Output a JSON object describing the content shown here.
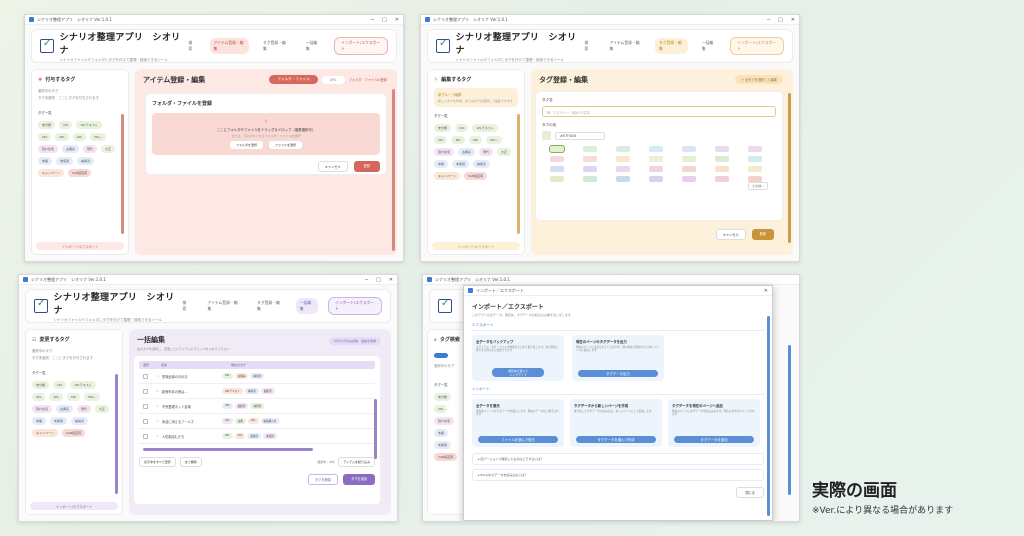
{
  "window": {
    "title": "シナリオ整理アプリ　シオリナ Ver.1.0.1",
    "controls": [
      "─",
      "□",
      "✕"
    ]
  },
  "app": {
    "title": "シナリオ整理アプリ　シオリナ",
    "subtitle": "シナリオファイルやフォルダにタグを付けて整理・検索できるツール",
    "nav": [
      "検索",
      "アイテム登録・編集",
      "タグ登録・編集",
      "一括編集"
    ],
    "import_export": "インポート/エクスポート"
  },
  "sidebar": {
    "assign_title": "付与するタグ",
    "edit_title": "編集するタグ",
    "change_title": "変更するタグ",
    "selected_label": "選択中のタグ",
    "clear": "クリア",
    "selected_hint": "タグ未選択　ここにタグを付与されます",
    "tag_list_label": "タグ一覧",
    "bottom_button": "インポート/エクスポート",
    "new_group": "新グループ編集",
    "new_group_hint": "新しいタグを作成、またはタグを選択して編集できます",
    "tags": [
      "未分類",
      "1PL",
      "1PLテキスト",
      "2PL",
      "3PL",
      "4PL",
      "5PL~",
      "隠れ住宅",
      "古典系",
      "現代",
      "大正",
      "未開",
      "倫理",
      "事件",
      "未使用",
      "納得済",
      "納品購入可",
      "キャンペーン",
      "SAN値直葬"
    ]
  },
  "panel1": {
    "title": "アイテム登録・編集",
    "toggle": [
      "フォルダ・ファイル",
      "URL"
    ],
    "toggle_extra": "フォルダ・ファイルの登録",
    "card_title": "フォルダ・ファイルを登録",
    "drop_text": "ここにフォルダやファイルをドラッグ＆ドロップ（複数選択可）",
    "drop_sub": "または、下のボタンからフォルダ・ファイルを選択",
    "btn_folder": "フォルダを選択",
    "btn_file": "ファイルを選択",
    "cancel": "キャンセル",
    "submit": "登録"
  },
  "panel2": {
    "title": "タグ登録・編集",
    "top_btn": "＋ 全タグを選択して編集",
    "name_label": "タグ名",
    "name_placeholder": "例：ミステリー（最大32文字）",
    "color_label": "タグの色",
    "color_value": "#E7F4D6",
    "custom": "その他...",
    "cancel": "キャンセル",
    "submit": "登録",
    "palette": [
      "#e3efd6",
      "#d9eedc",
      "#d6ede6",
      "#d6eaf0",
      "#dbe4f5",
      "#e3ddf3",
      "#eddaf0",
      "#f5d9e2",
      "#f7ddd6",
      "#f6e7d4",
      "#f3eed2",
      "#e7efcf",
      "#d8ecd6",
      "#d2ebec",
      "#d2def3",
      "#ddd6f0",
      "#edd5ec",
      "#f3d3de",
      "#f5d6cf",
      "#f6e1cc",
      "#f3ead0",
      "#e2ecc9",
      "#d3e9d6",
      "#ccd8ef",
      "#d6cfee",
      "#e9d0ea",
      "#f1cfd9",
      "#f2d2c9"
    ]
  },
  "panel3": {
    "title": "一括編集",
    "hint": "左のタグを選択し、変更したいアイテムにチェックを入れてください",
    "top_btn": "付与タグのみ反映　追加を登録",
    "col_select": "選択",
    "col_name": "名前",
    "col_tags": "現在のタグ",
    "rows": [
      {
        "name": "霊場全部のほのお",
        "tags": [
          "1PL",
          "古典系",
          "納得済"
        ]
      },
      {
        "name": "新宿市あの夜は…",
        "tags": [
          "2PLテキスト",
          "納得済",
          "最終済"
        ]
      },
      {
        "name": "不死整理ネット目場",
        "tags": [
          "1PL",
          "最終済",
          "納得済"
        ]
      },
      {
        "name": "永遠に消えるフールズ",
        "tags": [
          "1PL",
          "古典",
          "1PL",
          "納品購入可"
        ]
      },
      {
        "name": "人形劇ぼむたち",
        "tags": [
          "2PL",
          "1PL",
          "最終済",
          "未使用"
        ]
      }
    ],
    "select_all": "表示中をすべて選択",
    "deselect": "全て解除",
    "count": "選択中：0件",
    "filter": "アイテムを絞り込み",
    "remove": "タグを解除",
    "apply": "タグを適用"
  },
  "panel4": {
    "dialog_title_bar": "インポート／エクスポート",
    "title": "インポート／エクスポート",
    "desc": "このアプリの全データ、保存先、タグデータの読み込み書き出しをします",
    "export_label": "エクスポート",
    "import_label": "インポート",
    "export_cards": [
      {
        "title": "全データをバックアップ",
        "text": "全アイテム・タグ・フォルダ情報をまとめて書き出します。別の環境に移行する時などに使用できます",
        "button": "保存先を選んで\nバックアップ"
      },
      {
        "title": "現在のページのタグデータを出力",
        "text": "現在のページに表示されているタグを、他の端末で利用するためにファイルに保存します",
        "button": "タグデータ出力"
      }
    ],
    "import_cards": [
      {
        "title": "全データを復元",
        "text": "保存先ファイルから全データを復元します。現在のデータは上書きされます",
        "button": "ファイルを選んで復元"
      },
      {
        "title": "タグデータから新しいページを作成",
        "text": "書き出したタグデータを読み込み、新しいページとして追加します",
        "button": "タグデータを選んで作成"
      },
      {
        "title": "タグデータを現在のページへ追加",
        "text": "現在のページにタグデータを読み込みます。同名のタグはスキップされます",
        "button": "タグデータを追加"
      }
    ],
    "faq1": "旧バージョンで保存したものはどうするには？",
    "faq2": "Excelからデータを読み込むには？",
    "close": "閉じる",
    "side_title": "タグ検索"
  },
  "caption": {
    "main": "実際の画面",
    "note": "※Ver.により異なる場合があります"
  }
}
